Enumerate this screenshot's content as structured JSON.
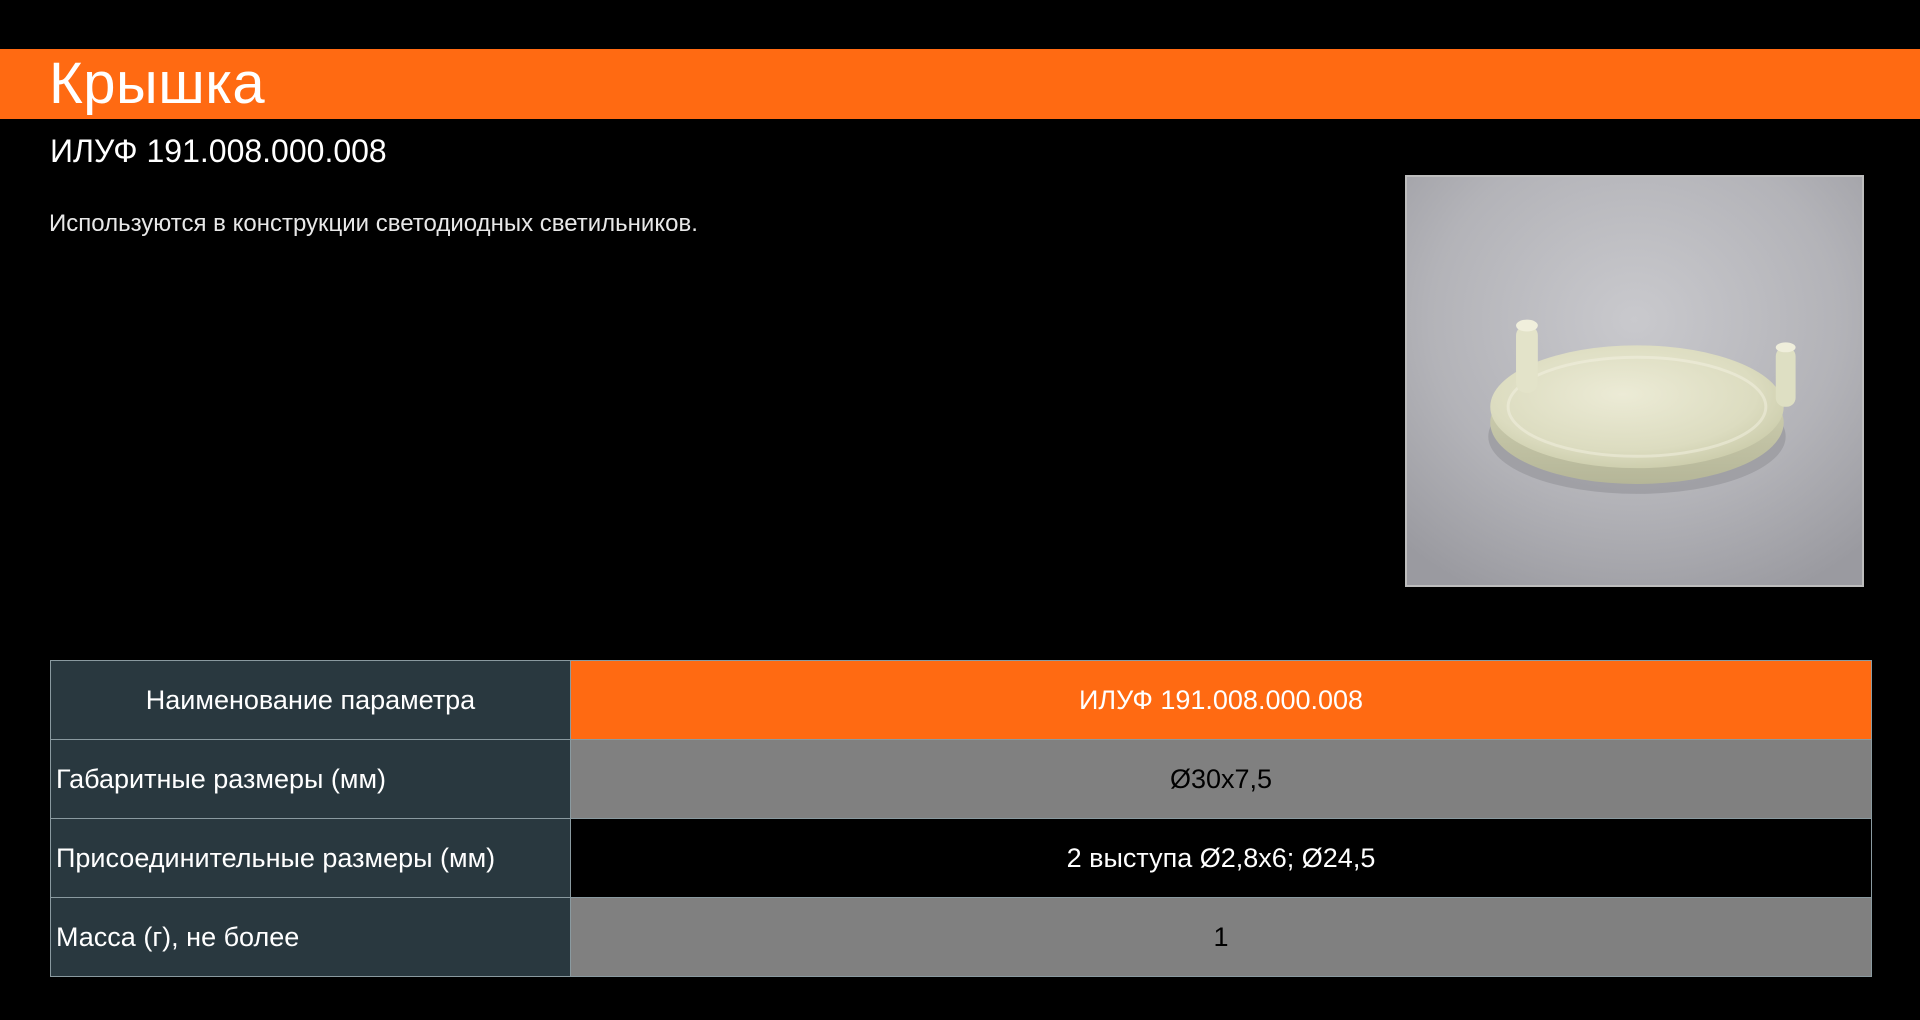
{
  "header": {
    "title": "Крышка",
    "accent_color": "#ff6a12"
  },
  "product": {
    "code": "ИЛУФ 191.008.000.008",
    "description": "Используются в конструкции светодиодных светильников."
  },
  "photo": {
    "icon": "product-photo-cap"
  },
  "table": {
    "header": {
      "name": "Наименование параметра",
      "value": "ИЛУФ 191.008.000.008"
    },
    "rows": [
      {
        "name": "Габаритные размеры (мм)",
        "value": "Ø30x7,5"
      },
      {
        "name": "Присоединительные размеры (мм)",
        "value": "2 выступа Ø2,8x6; Ø24,5"
      },
      {
        "name": "Масса (г), не более",
        "value": "1"
      }
    ],
    "colors": {
      "name_cell": "#29383f",
      "header_value": "#ff6a12",
      "row_grey": "#808080",
      "row_black": "#000000"
    }
  }
}
